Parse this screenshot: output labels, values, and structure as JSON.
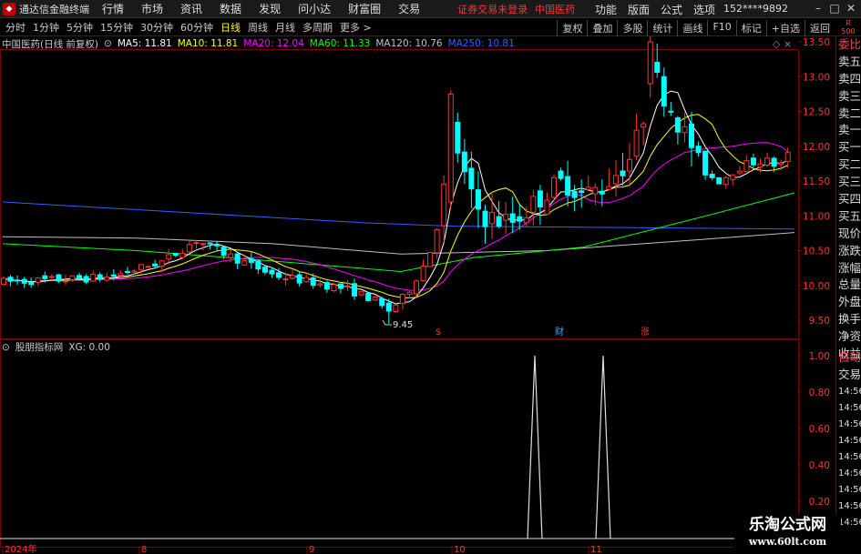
{
  "app": {
    "title": "通达信金融终端"
  },
  "menu": [
    "行情",
    "市场",
    "资讯",
    "数据",
    "发现",
    "问小达",
    "财富圈",
    "交易"
  ],
  "warning": "证券交易未登录",
  "stock_name": "中国医药",
  "right_menu": [
    "功能",
    "版面",
    "公式",
    "选项"
  ],
  "user": "152****9892",
  "periods": [
    "分时",
    "1分钟",
    "5分钟",
    "15分钟",
    "30分钟",
    "60分钟",
    "日线",
    "周线",
    "月线",
    "多周期",
    "更多 >"
  ],
  "active_period": "日线",
  "tools": [
    "复权",
    "叠加",
    "多股",
    "统计",
    "画线",
    "F10",
    "标记",
    "+自选",
    "返回"
  ],
  "r_badge": {
    "line1": "R",
    "line2": "500"
  },
  "main_header": {
    "title": "中国医药(日线 前复权)",
    "ma": [
      {
        "label": "MA5: 11.81",
        "color": "#ffffff"
      },
      {
        "label": "MA10: 11.81",
        "color": "#ffff00"
      },
      {
        "label": "MA20: 12.04",
        "color": "#ff00ff"
      },
      {
        "label": "MA60: 11.33",
        "color": "#00ff00"
      },
      {
        "label": "MA120: 10.76",
        "color": "#c0c0c0"
      },
      {
        "label": "MA250: 10.81",
        "color": "#3060ff"
      }
    ],
    "icons": "◇ ×"
  },
  "sub_header": {
    "indicator": "股朋指标网",
    "value": "XG: 0.00"
  },
  "right_panel": {
    "rows": [
      "委比",
      "卖五",
      "卖四",
      "卖三",
      "卖二",
      "卖一",
      "买一",
      "买二",
      "买三",
      "买四",
      "买五",
      "现价",
      "涨跌",
      "涨幅",
      "总量",
      "外盘",
      "换手",
      "净资",
      "收益"
    ],
    "lower": [
      "自动",
      "交易"
    ],
    "times": [
      "14:56",
      "14:56",
      "14:56",
      "14:56",
      "14:56",
      "14:56",
      "14:56",
      "14:56",
      "14:56"
    ]
  },
  "watermark": {
    "line1": "乐淘公式网",
    "line2": "www.60lt.com"
  },
  "colors": {
    "up": "#ff3232",
    "down": "#00ffff",
    "ma5": "#ffffff",
    "ma10": "#ffff00",
    "ma20": "#ff00ff",
    "ma60": "#00ff00",
    "ma120": "#c0c0c0",
    "ma250": "#3060ff",
    "grid": "#7a0000"
  },
  "chart_data": {
    "type": "candlestick",
    "y_ticks": [
      "13.50",
      "13.00",
      "12.50",
      "12.00",
      "11.50",
      "11.00",
      "10.50",
      "10.00",
      "9.50"
    ],
    "ylim": [
      9.3,
      14.2
    ],
    "high_label": "13.88",
    "low_label": "9.45",
    "event_marks": [
      "$",
      "财",
      "涨"
    ],
    "x_labels": [
      "2024年",
      "8",
      "9",
      "10",
      "11"
    ],
    "sub_ticks": [
      "1.00",
      "0.80",
      "0.60",
      "0.40",
      "0.20"
    ],
    "xg_signals": [
      1,
      1
    ]
  }
}
